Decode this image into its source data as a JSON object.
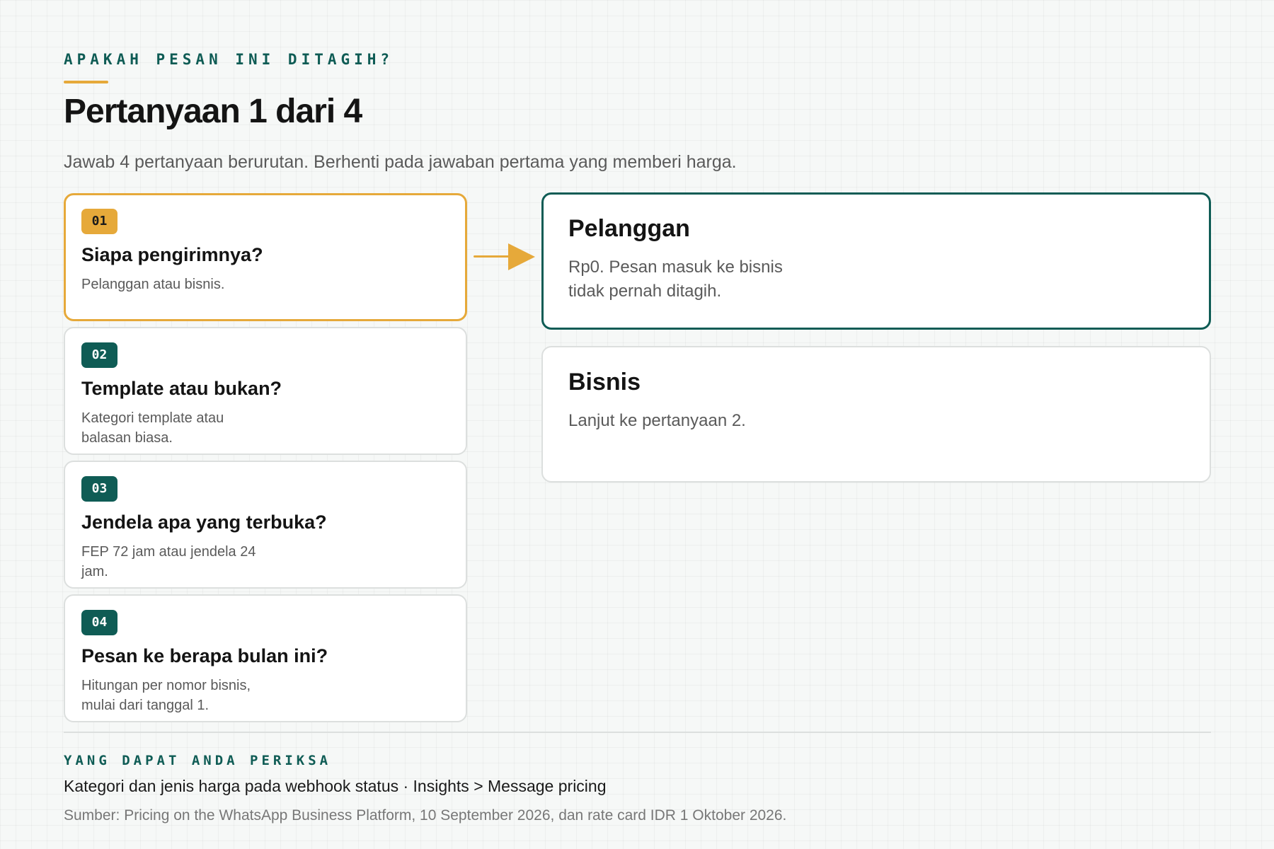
{
  "header": {
    "eyebrow": "APAKAH PESAN INI DITAGIH?",
    "title": "Pertanyaan 1 dari 4",
    "intro": "Jawab 4 pertanyaan berurutan. Berhenti pada jawaban pertama yang memberi harga."
  },
  "questions": [
    {
      "number": "01",
      "title": "Siapa pengirimnya?",
      "description": "Pelanggan atau bisnis."
    },
    {
      "number": "02",
      "title": "Template atau bukan?",
      "description": "Kategori template atau balasan biasa."
    },
    {
      "number": "03",
      "title": "Jendela apa yang terbuka?",
      "description": "FEP 72 jam atau jendela 24 jam."
    },
    {
      "number": "04",
      "title": "Pesan ke berapa bulan ini?",
      "description": "Hitungan per nomor bisnis, mulai dari tanggal 1."
    }
  ],
  "answers": [
    {
      "title": "Pelanggan",
      "description": "Rp0. Pesan masuk ke bisnis tidak pernah ditagih."
    },
    {
      "title": "Bisnis",
      "description": "Lanjut ke pertanyaan 2."
    }
  ],
  "footer": {
    "eyebrow": "YANG DAPAT ANDA PERIKSA",
    "checks": "Kategori dan jenis harga pada webhook status · Insights > Message pricing",
    "source": "Sumber: Pricing on the WhatsApp Business Platform, 10 September 2026, dan rate card IDR 1 Oktober 2026."
  },
  "colors": {
    "accent": "#e6a93a",
    "brand": "#0f5c55",
    "background": "#f6f8f7"
  }
}
